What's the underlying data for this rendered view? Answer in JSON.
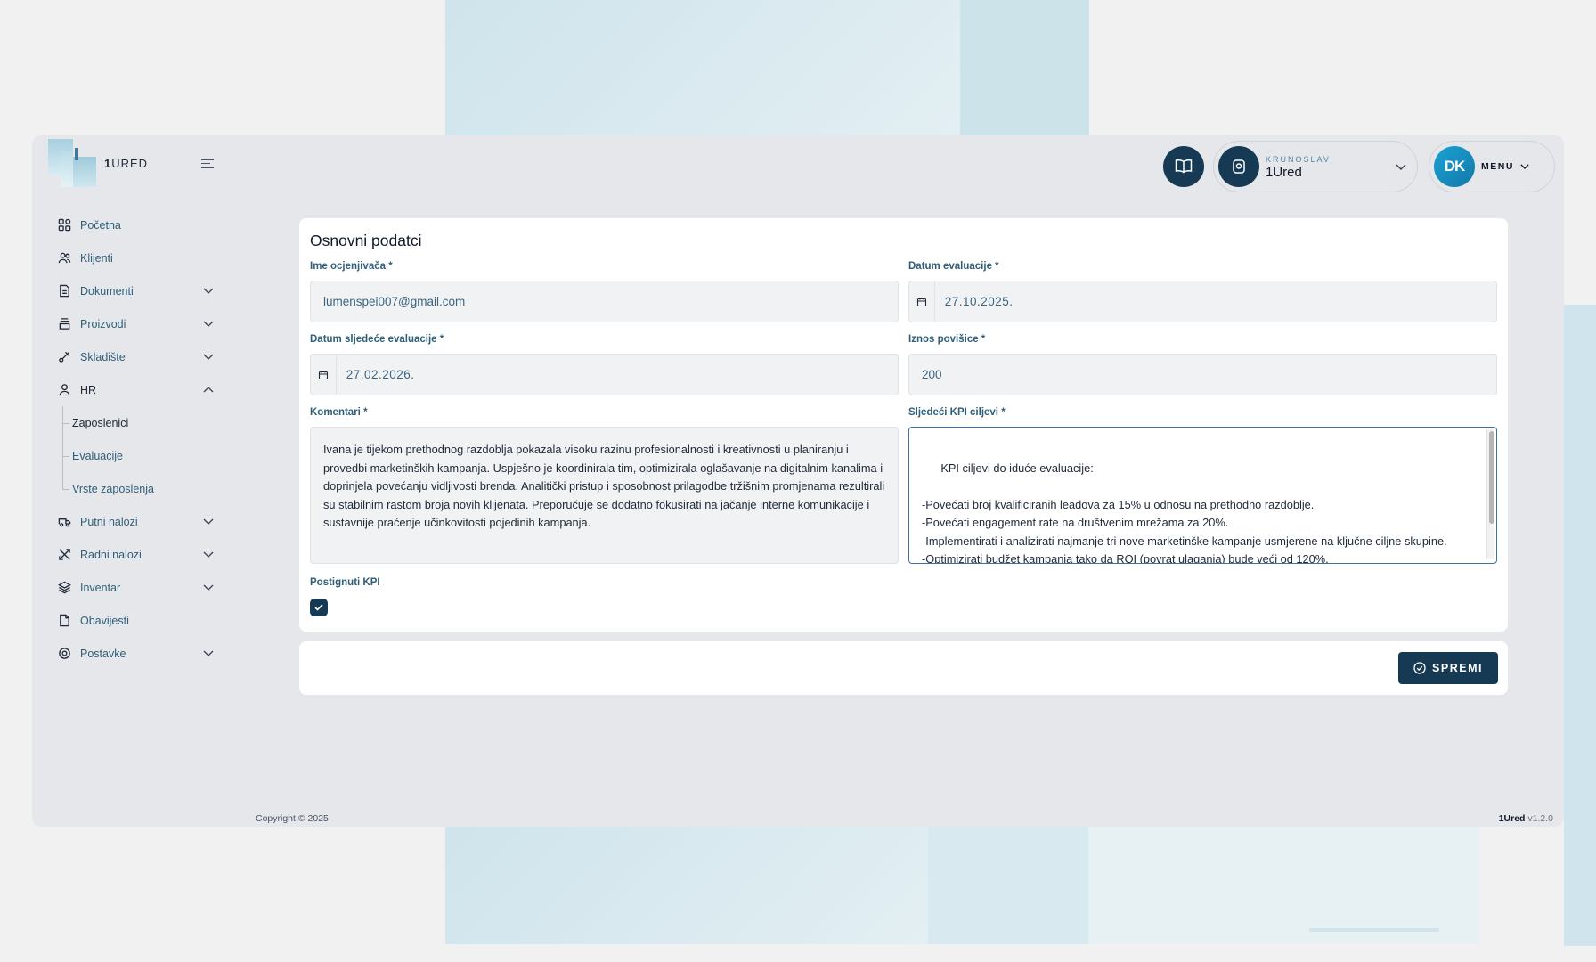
{
  "app": {
    "logo_text_bold": "1",
    "logo_text": "URED"
  },
  "sidebar": {
    "items": [
      {
        "label": "Početna"
      },
      {
        "label": "Klijenti"
      },
      {
        "label": "Dokumenti"
      },
      {
        "label": "Proizvodi"
      },
      {
        "label": "Skladište"
      },
      {
        "label": "HR"
      },
      {
        "label": "Putni nalozi"
      },
      {
        "label": "Radni nalozi"
      },
      {
        "label": "Inventar"
      },
      {
        "label": "Obavijesti"
      },
      {
        "label": "Postavke"
      }
    ],
    "hr_sub": [
      {
        "label": "Zaposlenici"
      },
      {
        "label": "Evaluacije"
      },
      {
        "label": "Vrste zaposlenja"
      }
    ]
  },
  "header": {
    "org_subtitle": "KRUNOSLAV",
    "org_name": "1Ured",
    "avatar_initials": "DK",
    "menu_label": "MENU"
  },
  "form": {
    "title": "Osnovni podatci",
    "evaluator_label": "Ime ocjenjivača *",
    "evaluator_value": "lumenspei007@gmail.com",
    "eval_date_label": "Datum evaluacije *",
    "eval_date_value": "27.10.2025.",
    "next_eval_label": "Datum sljedeće evaluacije *",
    "next_eval_value": "27.02.2026.",
    "raise_label": "Iznos povišice *",
    "raise_value": "200",
    "comment_label": "Komentari *",
    "comment_value": "Ivana je tijekom prethodnog razdoblja pokazala visoku razinu profesionalnosti i kreativnosti u planiranju i provedbi marketinških kampanja. Uspješno je koordinirala tim, optimizirala oglašavanje na digitalnim kanalima i doprinjela povećanju vidljivosti brenda. Analitički pristup i sposobnost prilagodbe tržišnim promjenama rezultirali su stabilnim rastom broja novih klijenata. Preporučuje se dodatno fokusirati na jačanje interne komunikacije i sustavnije praćenje učinkovitosti pojedinih kampanja.",
    "kpi_label": "Sljedeći KPI ciljevi *",
    "kpi_value": "KPI ciljevi do iduće evaluacije:\n\n-Povećati broj kvalificiranih leadova za 15% u odnosu na prethodno razdoblje.\n-Povećati engagement rate na društvenim mrežama za 20%.\n-Implementirati i analizirati najmanje tri nove marketinške kampanje usmjerene na ključne ciljne skupine.\n-Optimizirati budžet kampanja tako da ROI (povrat ulaganja) bude veći od 120%.",
    "kpi_achieved_label": "Postignuti KPI",
    "kpi_achieved": true,
    "save_label": "SPREMI"
  },
  "footer": {
    "copyright": "Copyright © 2025",
    "version_brand": "1Ured",
    "version": "v1.2.0"
  },
  "colors": {
    "primary": "#163a53",
    "accent": "#1aa3d4",
    "link": "#2f5f78"
  }
}
